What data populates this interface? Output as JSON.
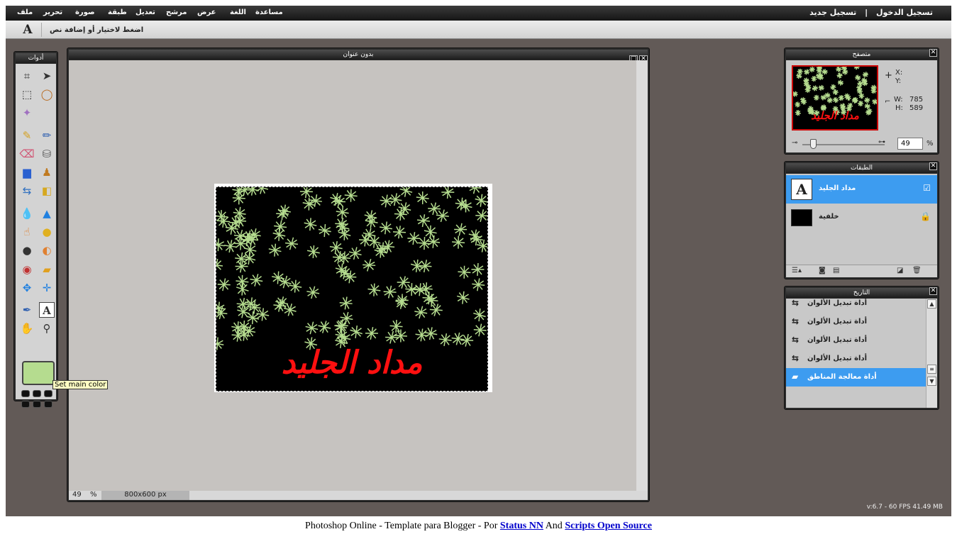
{
  "menu": [
    "ملف",
    "تحرير",
    "صورة",
    "طبقة",
    "تعديل",
    "مرشح",
    "عرض",
    "اللغة",
    "مساعدة"
  ],
  "auth": {
    "register": "تسجيل جديد",
    "separator": "|",
    "login": "تسجيل الدخول"
  },
  "options_bar": {
    "tool_glyph": "A",
    "hint": "اضغط لاختيار أو إضافة نص"
  },
  "tools_panel": {
    "title": "أدوات",
    "tooltip": "Set main color",
    "main_color": "#b5dc8f"
  },
  "canvas": {
    "title": "بدون عنوان",
    "zoom": "49",
    "zoom_unit": "%",
    "size": "800x600 px",
    "image_text": "مداد الجليد",
    "text_color": "#ff1010"
  },
  "navigator": {
    "title": "متصفح",
    "x_label": "X:",
    "y_label": "Y:",
    "w_label": "W:",
    "w_value": "785",
    "h_label": "H:",
    "h_value": "589",
    "zoom": "49",
    "zoom_unit": "%"
  },
  "layers": {
    "title": "الطبقات",
    "items": [
      {
        "name": "مداد الجليد",
        "thumb": "A",
        "selected": true,
        "status": "☑"
      },
      {
        "name": "خلفية",
        "thumb": "",
        "selected": false,
        "status": "🔒"
      }
    ]
  },
  "history": {
    "title": "التاريخ",
    "items": [
      "أداة تبديل الألوان",
      "أداة تبديل الألوان",
      "أداة تبديل الألوان",
      "أداة تبديل الألوان",
      "أداة معالجة المناطق"
    ]
  },
  "version": "v:6.7 - 60 FPS 41.49 MB",
  "footer": {
    "prefix": "Photoshop Online - Template para Blogger - Por",
    "link1": "Status NN",
    "middle": "And",
    "link2": "Scripts Open Source"
  }
}
